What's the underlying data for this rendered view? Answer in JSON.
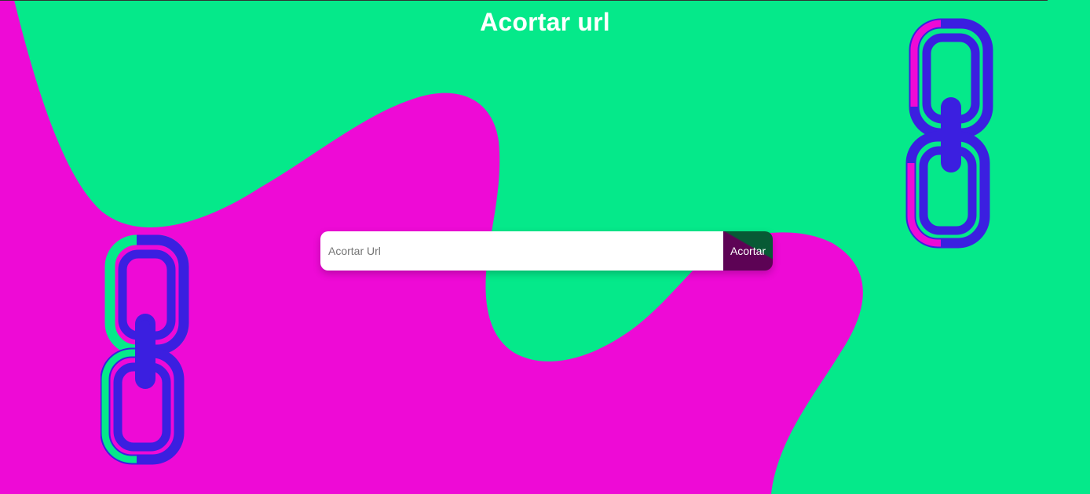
{
  "header": {
    "title": "Acortar url"
  },
  "form": {
    "input_placeholder": "Acortar Url",
    "input_value": "",
    "submit_label": "Acortar"
  },
  "colors": {
    "background_magenta": "#ee0ad6",
    "blob_green": "#05e98a",
    "chain_blue": "#3b1fe0",
    "button_dark": "#5d0355",
    "title_text": "#ffffff"
  },
  "icons": {
    "left_decoration": "chain-link-icon",
    "right_decoration": "chain-link-icon"
  }
}
